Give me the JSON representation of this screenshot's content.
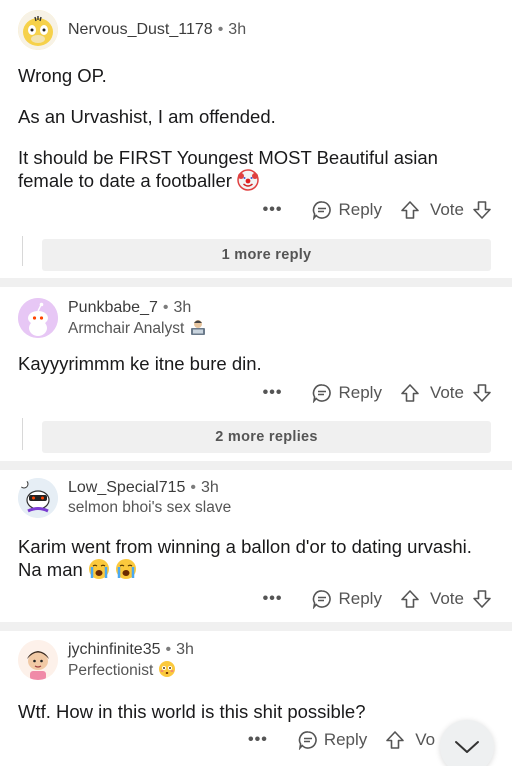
{
  "actions": {
    "more": "•••",
    "reply": "Reply",
    "vote": "Vote"
  },
  "comments": [
    {
      "username": "Nervous_Dust_1178",
      "time": "3h",
      "paragraphs": [
        "Wrong OP.",
        "As an Urvashist, I am offended.",
        "It should be FIRST  Youngest MOST Beautiful asian female to date a footballer"
      ],
      "emoji": "clown-face",
      "more_replies": "1 more reply"
    },
    {
      "username": "Punkbabe_7",
      "time": "3h",
      "flair": "Armchair Analyst",
      "flair_emoji": "technologist",
      "paragraphs": [
        "Kayyyrimmm ke itne bure din."
      ],
      "more_replies": "2 more replies"
    },
    {
      "username": "Low_Special715",
      "time": "3h",
      "flair": "selmon bhoi's sex slave",
      "paragraphs": [
        "Karim went from winning a ballon d'or to dating urvashi. Na man"
      ],
      "emoji": "loudly-crying-face"
    },
    {
      "username": "jychinfinite35",
      "time": "3h",
      "flair": "Perfectionist",
      "flair_emoji": "flushed-face",
      "paragraphs": [
        "Wtf. How in this world is this shit possible?"
      ],
      "vote_partial": "Vo"
    }
  ],
  "colors": {
    "text": "#1a1a1b",
    "meta": "#555555",
    "separator": "#f0f0f0"
  }
}
